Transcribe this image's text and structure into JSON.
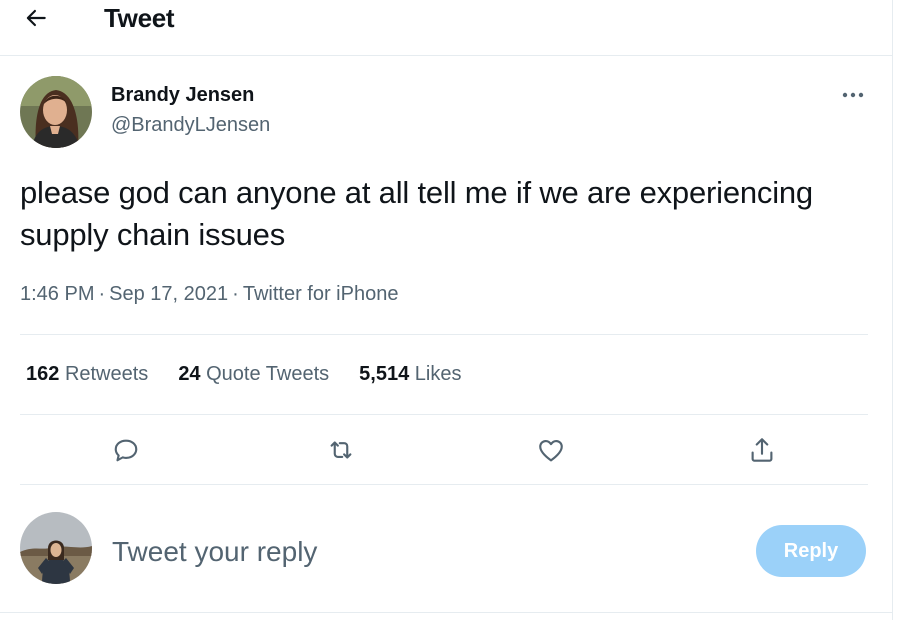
{
  "header": {
    "back_icon": "arrow-left-icon",
    "title": "Tweet"
  },
  "tweet": {
    "author": {
      "name": "Brandy Jensen",
      "handle": "@BrandyLJensen"
    },
    "more_icon": "more-dots-icon",
    "text": "please god can anyone at all tell me if we are experiencing supply chain issues",
    "time": "1:46 PM",
    "date": "Sep 17, 2021",
    "source": "Twitter for iPhone",
    "separator": "·",
    "stats": {
      "retweets_count": "162",
      "retweets_label": "Retweets",
      "quotes_count": "24",
      "quotes_label": "Quote Tweets",
      "likes_count": "5,514",
      "likes_label": "Likes"
    },
    "actions": [
      "reply-icon",
      "retweet-icon",
      "like-icon",
      "share-icon"
    ]
  },
  "reply": {
    "placeholder": "Tweet your reply",
    "button_label": "Reply",
    "button_color": "#9bd1f9"
  },
  "colors": {
    "text_primary": "#0f1419",
    "text_secondary": "#536471",
    "divider": "#e6ecf0"
  }
}
